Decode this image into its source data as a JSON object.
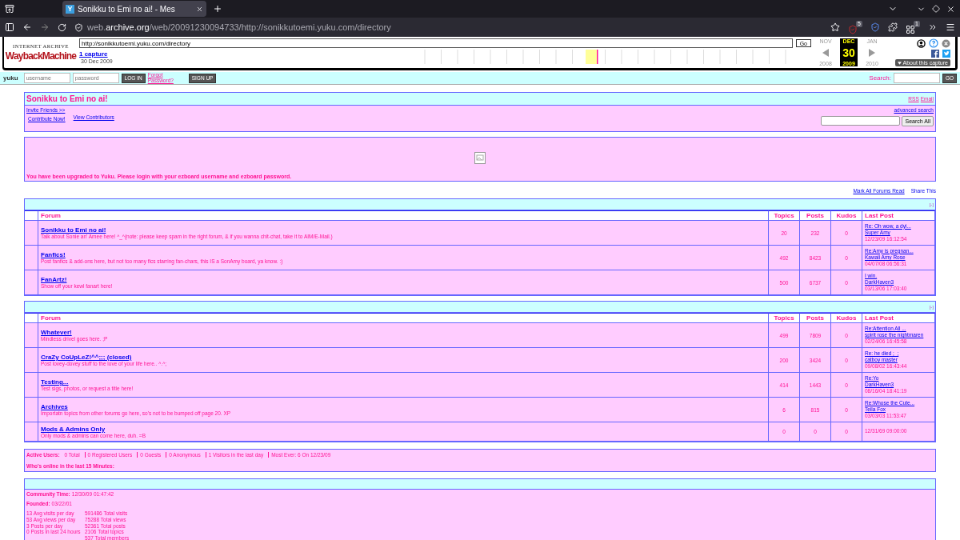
{
  "browser": {
    "tab_title": "Sonikku to Emi no ai! - Mes",
    "favicon": "Y",
    "url_prefix": "web.",
    "url_domain": "archive.org",
    "url_path": "/web/20091230094733/http://sonikkutoemi.yuku.com/directory",
    "badges": [
      "5",
      "1"
    ]
  },
  "wayback": {
    "logo_top": "INTERNET ARCHIVE",
    "logo": "WaybackMachine",
    "url_value": "http://sonikkutoemi.yuku.com/directory",
    "go": "Go",
    "captures": "1 capture",
    "capture_date": "30 Dec 2009",
    "prev": {
      "month": "NOV",
      "year": "2008"
    },
    "current": {
      "month": "DEC",
      "day": "30",
      "year": "2009"
    },
    "next": {
      "month": "JAN",
      "year": "2010"
    },
    "about": "About this capture"
  },
  "yuku_bar": {
    "logo": "yuku",
    "username_placeholder": "username",
    "password_placeholder": "password",
    "login": "LOG IN",
    "forgot": "Forgot Password?",
    "signup": "SIGN UP",
    "search_label": "Search:",
    "go": "GO"
  },
  "header": {
    "title": "Sonikku to Emi no ai!",
    "feeds": [
      "RSS",
      "Email"
    ],
    "invite": "Invite Friends >>",
    "contribute": "Contribute Now!",
    "contributors": "View Contributors",
    "advanced_search": "advanced search",
    "search_button": "Search All"
  },
  "notice": "You have been upgraded to Yuku. Please login with your ezboard username and ezboard password.",
  "actions": [
    "Mark All Forums Read",
    "Share This"
  ],
  "categories": [
    {
      "collapse": "[-]",
      "columns": [
        "Forum",
        "Topics",
        "Posts",
        "Kudos",
        "Last Post"
      ],
      "forums": [
        {
          "name": "Sonikku to Emi no ai!",
          "description": "Talk about Sonie an' Amee here! ^_^(note: please keep spam in the right forum, & if you wanna chit-chat, take it to AIM/E-Mail.)",
          "topics": "20",
          "posts": "232",
          "kudos": "0",
          "last_post": {
            "title": "Re: Oh wow, a dyi...",
            "author": "Super Amy",
            "time": "12/23/09 16:12:54"
          }
        },
        {
          "name": "Fanfics!",
          "description": "Post fanfics & add-ons here, but not too many fics starring fan-chars, this IS a SonAmy board, ya know. :)",
          "topics": "492",
          "posts": "8423",
          "kudos": "0",
          "last_post": {
            "title": "Re:Amy is pregnan...",
            "author": "Kawaii Amy Rose",
            "time": "04/07/08 06:56:31"
          }
        },
        {
          "name": "FanArtz!",
          "description": "Show off your kewl fanart here!",
          "topics": "500",
          "posts": "6737",
          "kudos": "0",
          "last_post": {
            "title": "I win.",
            "author": "DarkHaven3",
            "time": "03/13/06 17:03:40"
          }
        }
      ]
    },
    {
      "collapse": "[-]",
      "columns": [
        "Forum",
        "Topics",
        "Posts",
        "Kudos",
        "Last Post"
      ],
      "forums": [
        {
          "name": "Whatever!",
          "description": "Mindless drivel goes here. ;P",
          "topics": "499",
          "posts": "7809",
          "kudos": "0",
          "last_post": {
            "title": "Re:Attention All ...",
            "author": "spirit rose the nightmaren",
            "time": "02/24/06 16:45:58"
          }
        },
        {
          "name": "CraZy CoUpLeZ!^^;;; (closed)",
          "description": "Post lovey-dovey stuff to the love of your life here.. ^.^;",
          "topics": "200",
          "posts": "3424",
          "kudos": "0",
          "last_post": {
            "title": "Re: he died ;_;",
            "author": "catboy master",
            "time": "09/08/02 16:43:44"
          }
        },
        {
          "name": "Testing...",
          "description": "Test sigs, photos, or request a title here!",
          "topics": "414",
          "posts": "1443",
          "kudos": "0",
          "last_post": {
            "title": "Re:Yo",
            "author": "DarkHaven3",
            "time": "08/16/04 18:41:19"
          }
        },
        {
          "name": "Archives",
          "description": "Importatn topics from other forums go here, so's not to be bumped off page 20. XP",
          "topics": "6",
          "posts": "815",
          "kudos": "0",
          "last_post": {
            "title": "Re:Whose the Cute...",
            "author": "Teila Fox",
            "time": "03/03/03 11:53:47"
          }
        },
        {
          "name": "Mods & Admins Only",
          "description": "Only mods & admins can come here, duh. =B",
          "topics": "0",
          "posts": "0",
          "kudos": "0",
          "last_post": {
            "time": "12/31/69 09:00:00"
          }
        }
      ]
    }
  ],
  "online": {
    "label": "Active Users:",
    "stats": [
      "0 Total",
      "0 Registered Users",
      "0 Guests",
      "0 Anonymous",
      "1 Visitors in the last day",
      "Most Ever: 6 On 12/23/09"
    ],
    "who": "Who's online in the last 15 Minutes:"
  },
  "stats": {
    "time_label": "Community Time:",
    "time": "12/30/09 01:47:42",
    "founded_label": "Founded:",
    "founded": "03/22/01",
    "left": [
      "13 Avg visits per day",
      "53 Avg views per day",
      "3 Posts per day",
      "0 Posts in last 24 hours"
    ],
    "right": [
      "591486 Total visits",
      "75288 Total views",
      "52361 Total posts",
      "2106 Total topics",
      "537 Total members"
    ]
  }
}
